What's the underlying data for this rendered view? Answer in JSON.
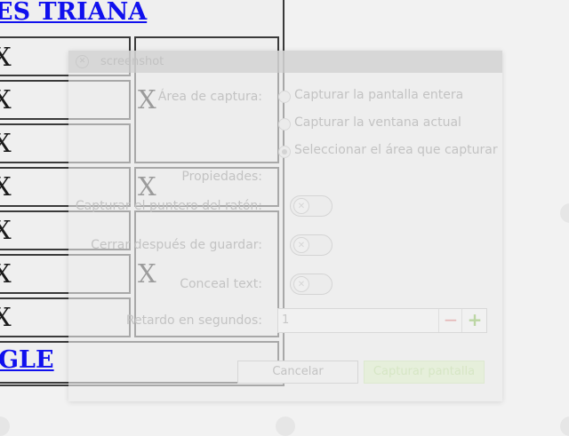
{
  "background": {
    "heading_top": "ES TRIANA",
    "heading_bottom": "GLE",
    "cell_mark": "X"
  },
  "dialog": {
    "title": "screenshot",
    "capture_area": {
      "label": "Área de captura:",
      "options": [
        "Capturar la pantalla entera",
        "Capturar la ventana actual",
        "Seleccionar el área que capturar"
      ],
      "selected_index": 2
    },
    "properties_label": "Propiedades:",
    "toggles": [
      {
        "label": "Capturar el puntero del ratón:",
        "on": false
      },
      {
        "label": "Cerrar después de guardar:",
        "on": false
      },
      {
        "label": "Conceal text:",
        "on": false
      }
    ],
    "delay": {
      "label": "Retardo en segundos:",
      "value": "1",
      "minus": "−",
      "plus": "+"
    },
    "buttons": {
      "cancel": "Cancelar",
      "capture": "Capturar pantalla"
    },
    "colors": {
      "accent_green": "#8ab35a",
      "minus_red": "#c85a5a"
    }
  }
}
